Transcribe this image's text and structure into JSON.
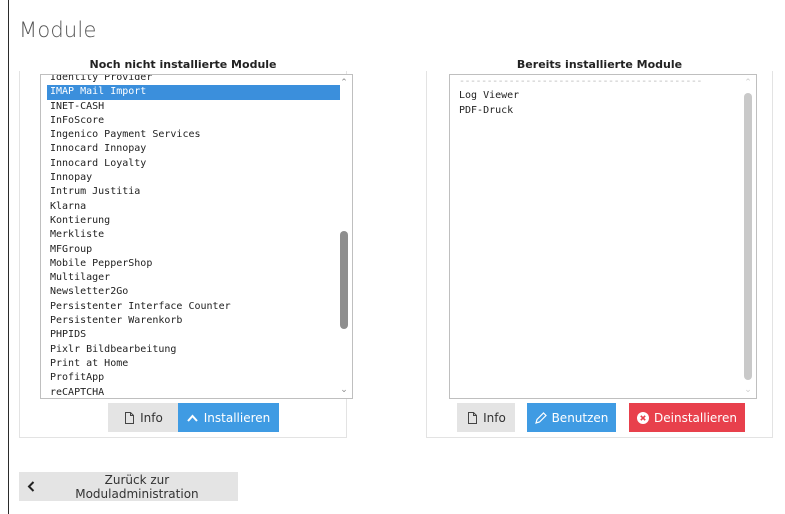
{
  "page": {
    "title": "Module"
  },
  "left_panel": {
    "heading": "Noch nicht installierte Module",
    "items": [
      "Identity Provider",
      "IMAP Mail Import",
      "INET-CASH",
      "InFoScore",
      "Ingenico Payment Services",
      "Innocard Innopay",
      "Innocard Loyalty",
      "Innopay",
      "Intrum Justitia",
      "Klarna",
      "Kontierung",
      "Merkliste",
      "MFGroup",
      "Mobile PepperShop",
      "Multilager",
      "Newsletter2Go",
      "Persistenter Interface Counter",
      "Persistenter Warenkorb",
      "PHPIDS",
      "Pixlr Bildbearbeitung",
      "Print at Home",
      "ProfitApp",
      "reCAPTCHA"
    ],
    "selected_item": "IMAP Mail Import",
    "buttons": {
      "info": "Info",
      "install": "Installieren"
    }
  },
  "right_panel": {
    "heading": "Bereits installierte Module",
    "separator": "--------------------------------------------",
    "items": [
      "Log Viewer",
      "PDF-Druck"
    ],
    "buttons": {
      "info": "Info",
      "use": "Benutzen",
      "uninstall": "Deinstallieren"
    }
  },
  "footer": {
    "back_label": "Zurück zur Moduladministration"
  },
  "icons": {
    "info": "file-icon",
    "install": "chevron-up-icon",
    "use": "pencil-icon",
    "uninstall": "times-circle-icon",
    "back": "chevron-left-icon"
  },
  "colors": {
    "primary": "#3f9be3",
    "danger": "#e8404c",
    "selection": "#3b8fdc",
    "default_button": "#e4e4e4"
  }
}
